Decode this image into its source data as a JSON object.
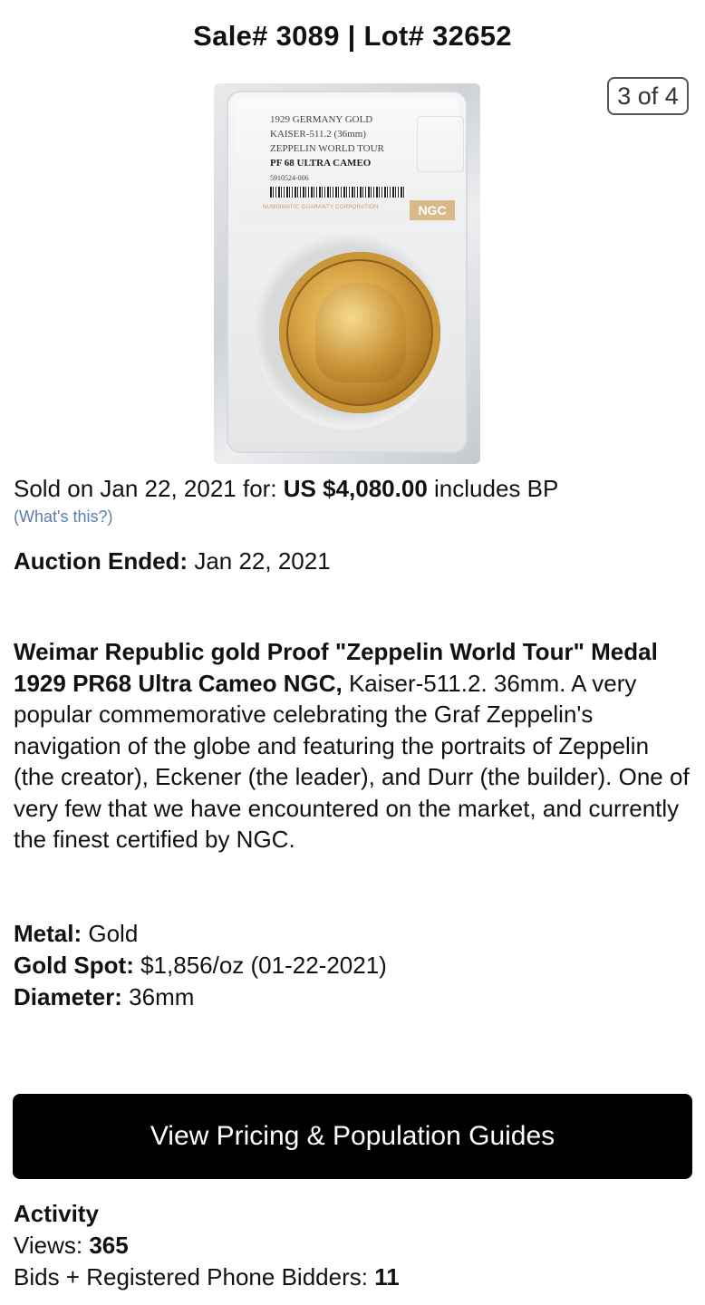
{
  "header": {
    "title": "Sale# 3089 | Lot# 32652",
    "image_counter": "3 of 4"
  },
  "image": {
    "slab_label": {
      "line1": "1929 GERMANY GOLD",
      "line2": "KAISER-511.2 (36mm)",
      "line3": "ZEPPELIN WORLD TOUR",
      "line4": "PF 68 ULTRA CAMEO",
      "cert": "5910524-006",
      "grader": "NUMISMATIC GUARANTY CORPORATION",
      "logo": "NGC"
    }
  },
  "sale": {
    "sold_prefix": "Sold on Jan 22, 2021 for:",
    "price": "US $4,080.00",
    "price_suffix": "includes BP",
    "whats_this": "(What's this?)",
    "ended_label": "Auction Ended:",
    "ended_value": "Jan 22, 2021"
  },
  "description": {
    "title": "Weimar Republic gold Proof \"Zeppelin World Tour\" Medal 1929 PR68 Ultra Cameo NGC,",
    "body": "Kaiser-511.2. 36mm. A very popular commemorative celebrating the Graf Zeppelin's navigation of the globe and featuring the portraits of Zeppelin (the creator), Eckener (the leader), and Durr (the builder). One of very few that we have encountered on the market, and currently the finest certified by NGC."
  },
  "specs": {
    "metal_label": "Metal:",
    "metal_value": "Gold",
    "spot_label": "Gold Spot:",
    "spot_value": "$1,856/oz (01-22-2021)",
    "diameter_label": "Diameter:",
    "diameter_value": "36mm"
  },
  "cta": {
    "label": "View Pricing & Population Guides"
  },
  "activity": {
    "heading": "Activity",
    "views_label": "Views:",
    "views_value": "365",
    "bids_label": "Bids + Registered Phone Bidders:",
    "bids_value": "11"
  }
}
